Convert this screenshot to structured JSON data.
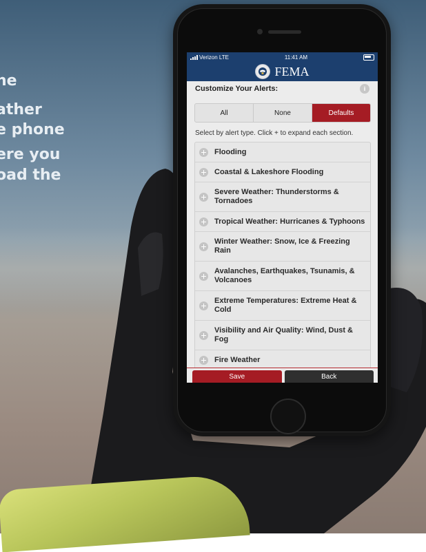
{
  "background_overlay": {
    "lines": [
      "ne",
      "ather",
      "e phone",
      "ere you",
      "oad the"
    ]
  },
  "status_bar": {
    "carrier": "Verizon",
    "network": "LTE",
    "time": "11:41 AM"
  },
  "app_header": {
    "title": "FEMA",
    "logo": "dhs-seal-icon"
  },
  "section": {
    "title": "Customize Your Alerts:",
    "info_icon": "info-icon",
    "info_glyph": "i"
  },
  "segments": [
    {
      "label": "All",
      "active": false
    },
    {
      "label": "None",
      "active": false
    },
    {
      "label": "Defaults",
      "active": true
    }
  ],
  "hint_text": "Select by alert type. Click + to expand each section.",
  "alert_types": [
    {
      "label": "Flooding"
    },
    {
      "label": "Coastal & Lakeshore Flooding"
    },
    {
      "label": "Severe Weather: Thunderstorms & Tornadoes"
    },
    {
      "label": "Tropical Weather: Hurricanes & Typhoons"
    },
    {
      "label": "Winter Weather: Snow, Ice & Freezing Rain"
    },
    {
      "label": "Avalanches, Earthquakes, Tsunamis, & Volcanoes"
    },
    {
      "label": "Extreme Temperatures: Extreme Heat & Cold"
    },
    {
      "label": "Visibility and Air Quality: Wind, Dust & Fog"
    },
    {
      "label": "Fire Weather"
    }
  ],
  "buttons": {
    "save": "Save",
    "back": "Back"
  },
  "colors": {
    "header_blue": "#1c3f6e",
    "accent_red": "#a51c24"
  }
}
